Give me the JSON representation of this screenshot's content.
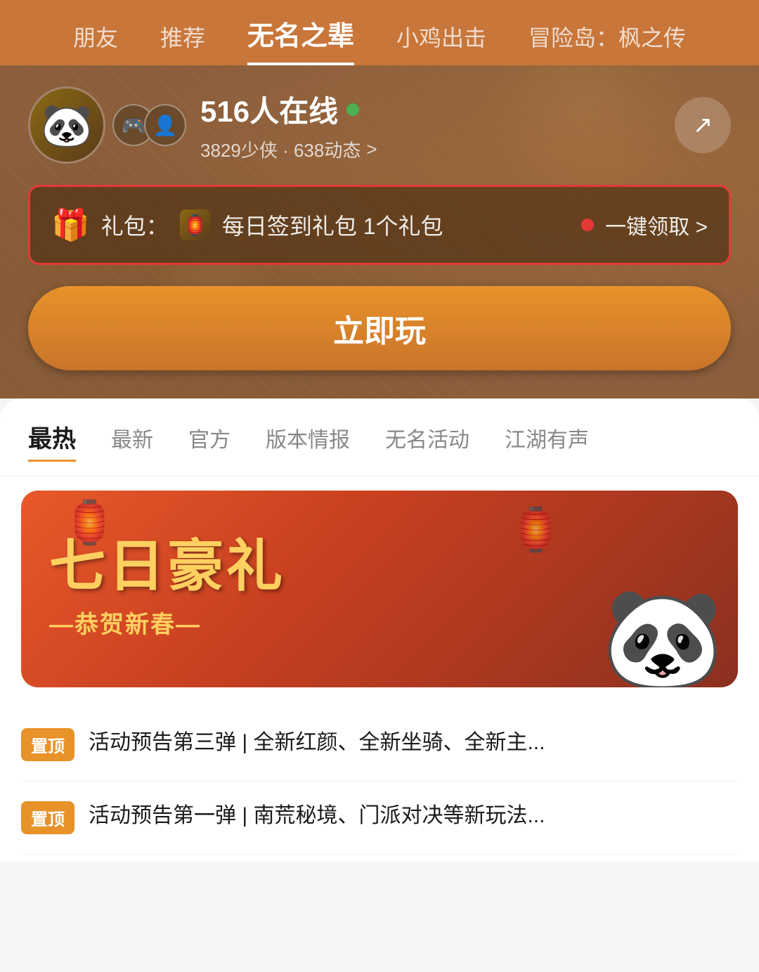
{
  "nav": {
    "items": [
      {
        "label": "朋友",
        "active": false
      },
      {
        "label": "推荐",
        "active": false
      },
      {
        "label": "无名之辈",
        "active": true
      },
      {
        "label": "小鸡出击",
        "active": false
      },
      {
        "label": "冒险岛：枫之传",
        "active": false
      }
    ]
  },
  "profile": {
    "online_count": "516人在线",
    "sub_info": "3829少侠 · 638动态",
    "sub_info_arrow": ">"
  },
  "gift": {
    "icon": "🎁",
    "label": "礼包：",
    "gift_text": "每日签到礼包 1个礼包",
    "action": "一键领取 >"
  },
  "play_button": {
    "label": "立即玩"
  },
  "content_tabs": [
    {
      "label": "最热",
      "active": true
    },
    {
      "label": "最新",
      "active": false
    },
    {
      "label": "官方",
      "active": false
    },
    {
      "label": "版本情报",
      "active": false
    },
    {
      "label": "无名活动",
      "active": false
    },
    {
      "label": "江湖有声",
      "active": false
    }
  ],
  "banner": {
    "title": "七日豪礼",
    "subtitle": "—恭贺新春—"
  },
  "posts": [
    {
      "tag": "置顶",
      "text": "活动预告第三弹 | 全新红颜、全新坐骑、全新主..."
    },
    {
      "tag": "置顶",
      "text": "活动预告第一弹 | 南荒秘境、门派对决等新玩法..."
    }
  ],
  "icons": {
    "share": "↗",
    "chevron_right": ">"
  },
  "colors": {
    "accent_orange": "#e8922a",
    "hero_bg": "#8B5E3C",
    "online_green": "#4caf50",
    "red_highlight": "#e53935"
  }
}
